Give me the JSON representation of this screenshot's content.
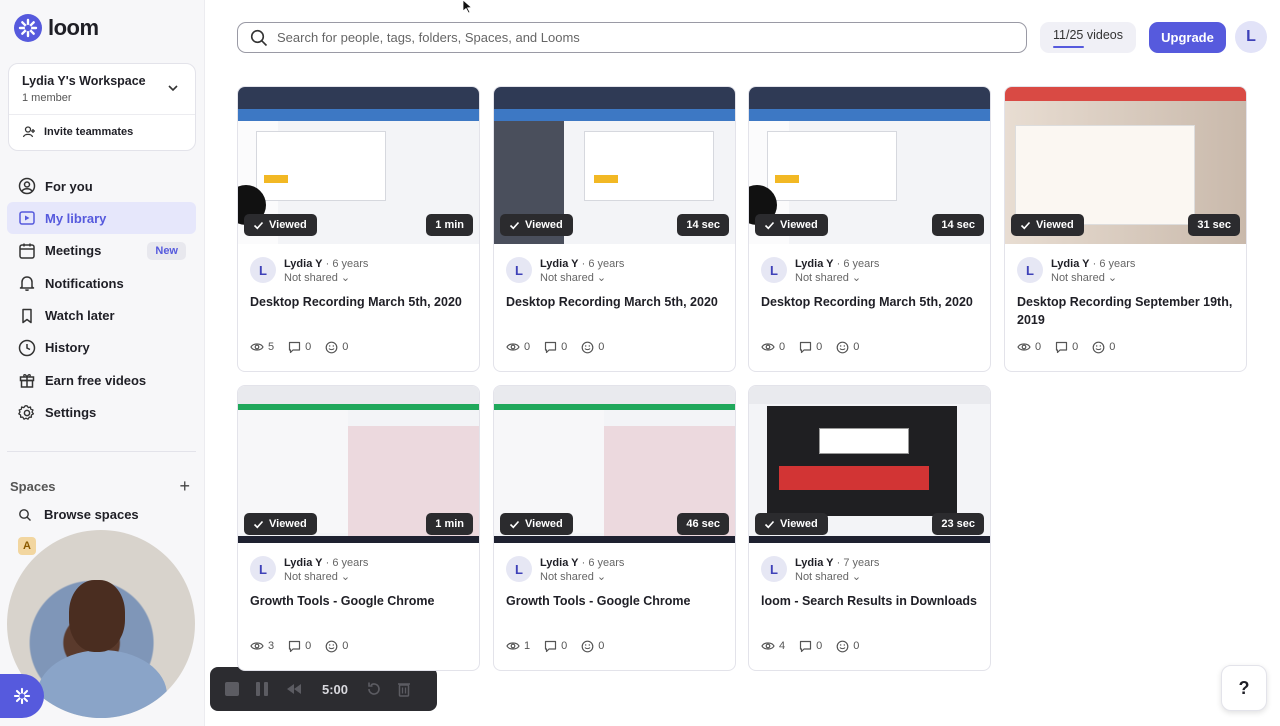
{
  "brand": {
    "name": "loom",
    "accent": "#565add"
  },
  "workspace": {
    "name": "Lydia Y's Workspace",
    "members": "1 member",
    "invite": "Invite teammates"
  },
  "nav": [
    {
      "label": "For you",
      "icon": "user-circle-icon"
    },
    {
      "label": "My library",
      "icon": "library-icon",
      "active": true
    },
    {
      "label": "Meetings",
      "icon": "calendar-icon",
      "badge": "New"
    },
    {
      "label": "Notifications",
      "icon": "bell-icon"
    },
    {
      "label": "Watch later",
      "icon": "bookmark-icon"
    },
    {
      "label": "History",
      "icon": "clock-icon"
    },
    {
      "label": "Earn free videos",
      "icon": "gift-icon"
    },
    {
      "label": "Settings",
      "icon": "gear-icon"
    }
  ],
  "spaces": {
    "heading": "Spaces",
    "browse": "Browse spaces",
    "item_partial": "A"
  },
  "search": {
    "placeholder": "Search for people, tags, folders, Spaces, and Looms"
  },
  "header": {
    "count": "11/25 videos",
    "count_progress": 0.44,
    "upgrade": "Upgrade",
    "avatar": "L"
  },
  "recorder": {
    "time": "5:00"
  },
  "help": {
    "label": "?"
  },
  "videos": [
    {
      "title": "Desktop Recording March 5th, 2020",
      "duration": "1 min",
      "owner": "Lydia Y",
      "age": "6 years",
      "sharing": "Not shared",
      "views": "5",
      "comments": "0",
      "reactions": "0",
      "viewed": "Viewed",
      "avatar": "L"
    },
    {
      "title": "Desktop Recording March 5th, 2020",
      "duration": "14 sec",
      "owner": "Lydia Y",
      "age": "6 years",
      "sharing": "Not shared",
      "views": "0",
      "comments": "0",
      "reactions": "0",
      "viewed": "Viewed",
      "avatar": "L"
    },
    {
      "title": "Desktop Recording March 5th, 2020",
      "duration": "14 sec",
      "owner": "Lydia Y",
      "age": "6 years",
      "sharing": "Not shared",
      "views": "0",
      "comments": "0",
      "reactions": "0",
      "viewed": "Viewed",
      "avatar": "L"
    },
    {
      "title": "Desktop Recording September 19th, 2019",
      "duration": "31 sec",
      "owner": "Lydia Y",
      "age": "6 years",
      "sharing": "Not shared",
      "views": "0",
      "comments": "0",
      "reactions": "0",
      "viewed": "Viewed",
      "avatar": "L"
    },
    {
      "title": "Growth Tools - Google Chrome",
      "duration": "1 min",
      "owner": "Lydia Y",
      "age": "6 years",
      "sharing": "Not shared",
      "views": "3",
      "comments": "0",
      "reactions": "0",
      "viewed": "Viewed",
      "avatar": "L"
    },
    {
      "title": "Growth Tools - Google Chrome",
      "duration": "46 sec",
      "owner": "Lydia Y",
      "age": "6 years",
      "sharing": "Not shared",
      "views": "1",
      "comments": "0",
      "reactions": "0",
      "viewed": "Viewed",
      "avatar": "L"
    },
    {
      "title": "loom - Search Results in Downloads",
      "duration": "23 sec",
      "owner": "Lydia Y",
      "age": "7 years",
      "sharing": "Not shared",
      "views": "4",
      "comments": "0",
      "reactions": "0",
      "viewed": "Viewed",
      "avatar": "L"
    }
  ]
}
